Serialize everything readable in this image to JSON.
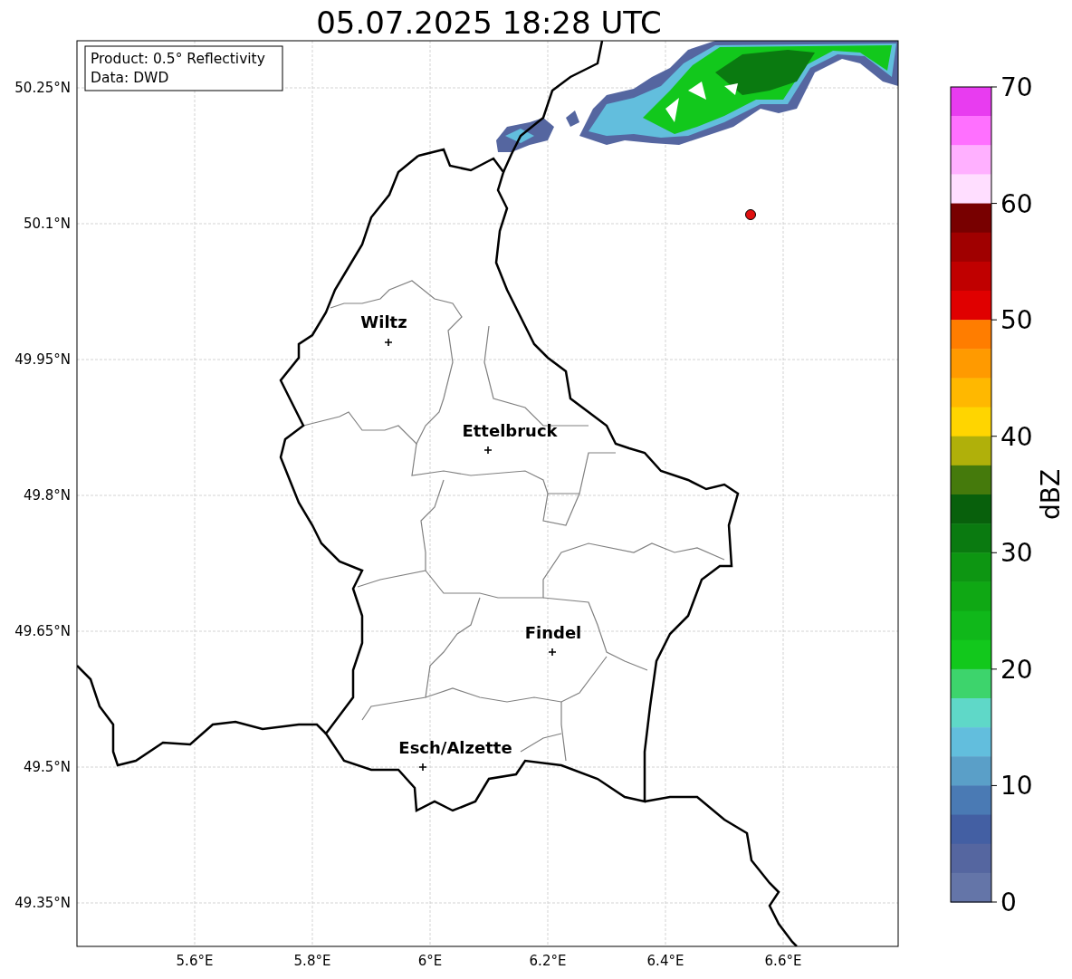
{
  "title": "05.07.2025 18:28 UTC",
  "info_box": [
    "Product: 0.5° Reflectivity",
    "Data: DWD"
  ],
  "map": {
    "lat_ticks": [
      "50.25°N",
      "50.1°N",
      "49.95°N",
      "49.8°N",
      "49.65°N",
      "49.5°N",
      "49.35°N"
    ],
    "lon_ticks": [
      "5.6°E",
      "5.8°E",
      "6°E",
      "6.2°E",
      "6.4°E",
      "6.6°E"
    ],
    "cities": [
      {
        "name": "Wiltz"
      },
      {
        "name": "Ettelbruck"
      },
      {
        "name": "Findel"
      },
      {
        "name": "Esch/Alzette"
      }
    ]
  },
  "colorbar": {
    "label": "dBZ",
    "ticks": [
      "70",
      "60",
      "50",
      "40",
      "30",
      "20",
      "10",
      "0"
    ],
    "bins": [
      {
        "color": "#e83cf0"
      },
      {
        "color": "#ff70ff"
      },
      {
        "color": "#ffb0ff"
      },
      {
        "color": "#ffdeff"
      },
      {
        "color": "#780000"
      },
      {
        "color": "#a00000"
      },
      {
        "color": "#c00000"
      },
      {
        "color": "#e00000"
      },
      {
        "color": "#ff7d00"
      },
      {
        "color": "#ff9a00"
      },
      {
        "color": "#ffb800"
      },
      {
        "color": "#ffd500"
      },
      {
        "color": "#b0b00a"
      },
      {
        "color": "#457a0c"
      },
      {
        "color": "#08600c"
      },
      {
        "color": "#0a7a10"
      },
      {
        "color": "#0d9612"
      },
      {
        "color": "#0fa814"
      },
      {
        "color": "#10b81a"
      },
      {
        "color": "#12c81c"
      },
      {
        "color": "#3dd46c"
      },
      {
        "color": "#5fd8c8"
      },
      {
        "color": "#62bedd"
      },
      {
        "color": "#5a9fc8"
      },
      {
        "color": "#4a7ab4"
      },
      {
        "color": "#435fa3"
      },
      {
        "color": "#5566a0"
      },
      {
        "color": "#6475a8"
      }
    ]
  }
}
